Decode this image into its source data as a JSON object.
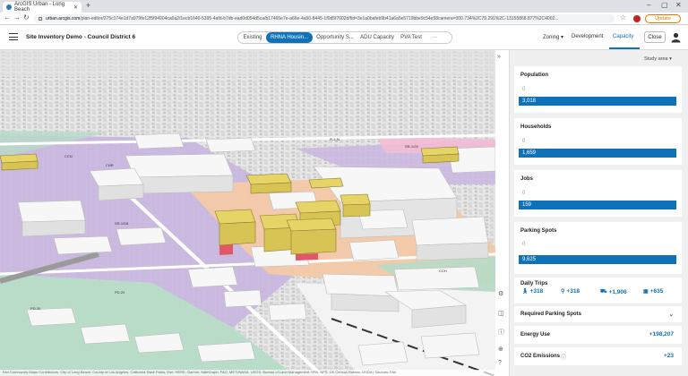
{
  "browser": {
    "tab_title": "ArcGIS Urban - Long Beach",
    "url_domain": "urban.arcgis.com",
    "url_rest": "/plan-editor/275c174e1d7a979fe12f5f94904ca0a2/1ecb1640-5395-4afd-b7db-ead0d054d5ca/b17465e7e-a66e-4a50-8445-1f0d5f7602d/fid=3e1a0bafeb9b41a6a5e5719bbe9c54e58camera=300.734%2C79.291%2C-13155868.877%2C4002...",
    "update_label": "Update"
  },
  "app": {
    "title": "Site Inventory Demo - Council District 6",
    "scenarios": [
      {
        "label": "Existing"
      },
      {
        "label": "RHNA Housin..."
      },
      {
        "label": "Opportunity S..."
      },
      {
        "label": "ADU Capacity"
      },
      {
        "label": "PVA Test"
      },
      {
        "label": "···"
      }
    ],
    "zoning_label": "Zoning ▾",
    "development_label": "Development",
    "capacity_label": "Capacity",
    "close_label": "Close"
  },
  "map": {
    "labels": [
      "SR-1/25",
      "R-3-N",
      "CCN",
      "SR-1/D8",
      "CNR",
      "PD-29",
      "PD-30",
      "CCH"
    ],
    "attribution": "Esri Community Maps Contributors, City of Long Beach, County of Los Angeles, California State Parks, Esri, HERE, Garmin, SafeGraph, FAO, METI/NASA, USGS, Bureau of Land Management, EPA, NPS, US Census Bureau, USDA | Sources: Esri"
  },
  "panel": {
    "study_area_label": "Study area ▾",
    "metrics": [
      {
        "label": "Population",
        "min": "0",
        "value": "3,018"
      },
      {
        "label": "Households",
        "min": "0",
        "value": "1,659"
      },
      {
        "label": "Jobs",
        "min": "0",
        "value": "159"
      },
      {
        "label": "Parking Spots",
        "min": "0",
        "value": "9,625"
      }
    ],
    "daily_trips": {
      "label": "Daily Trips",
      "items": [
        {
          "icon": "walk-icon",
          "value": "+318"
        },
        {
          "icon": "bike-icon",
          "value": "+318"
        },
        {
          "icon": "car-icon",
          "value": "+1,906"
        },
        {
          "icon": "bus-icon",
          "value": "+635"
        }
      ]
    },
    "required_parking": {
      "label": "Required Parking Spots"
    },
    "energy": {
      "label": "Energy Use",
      "value": "+198,207"
    },
    "co2": {
      "label": "CO2 Emissions",
      "value": "+23"
    }
  },
  "colors": {
    "accent": "#0f72b8",
    "zone_residential": "#c9b6e0",
    "zone_commercial": "#f3c9a6",
    "zone_open": "#b7dcc8",
    "zone_mixed": "#f3bcd4",
    "building_highlight": "#e6d466"
  }
}
